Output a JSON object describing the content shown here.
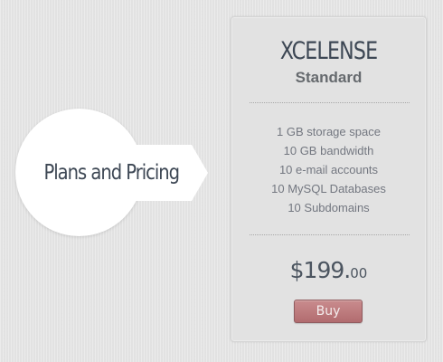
{
  "badge": {
    "label": "Plans and Pricing"
  },
  "plan": {
    "brand": "XCELENSE",
    "tier": "Standard",
    "features": [
      "1 GB storage space",
      "10 GB bandwidth",
      "10 e-mail accounts",
      "10 MySQL Databases",
      "10 Subdomains"
    ],
    "price_main": "$199.",
    "price_cents": "00",
    "buy_label": "Buy"
  },
  "colors": {
    "background": "#e6e6e6",
    "card": "#e2e2e2",
    "badge": "#ffffff",
    "heading_text": "#3d4754",
    "body_text": "#737780",
    "button": "#b97a7d"
  }
}
